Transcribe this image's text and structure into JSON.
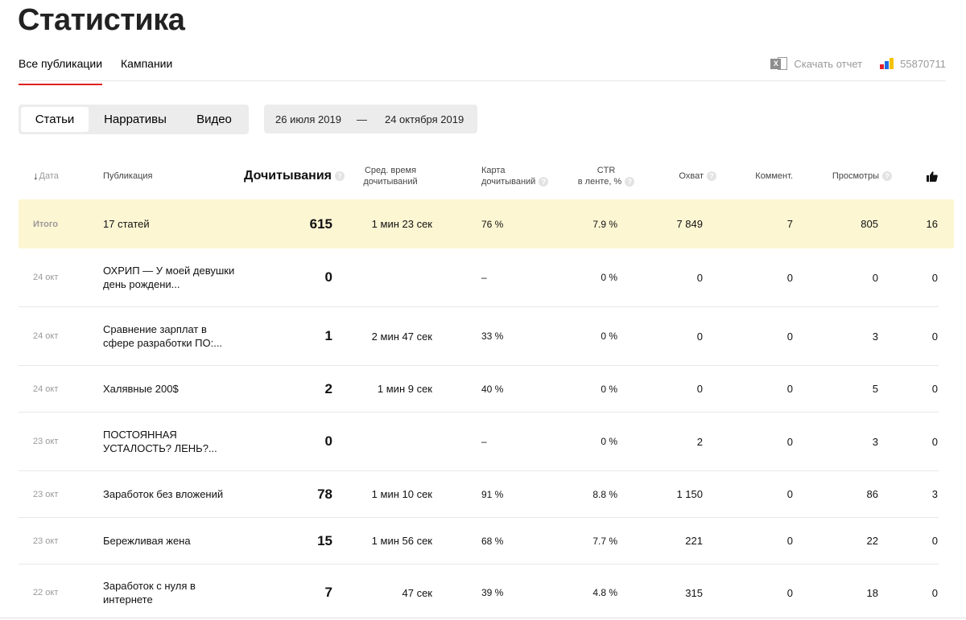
{
  "page": {
    "title": "Статистика"
  },
  "tabs": [
    {
      "label": "Все публикации",
      "active": true
    },
    {
      "label": "Кампании",
      "active": false
    }
  ],
  "actions": {
    "download_label": "Скачать отчет",
    "download_icon": "excel-icon",
    "counter_id": "55870711",
    "counter_icon": "metrica-icon"
  },
  "type_switch": {
    "options": [
      "Статьи",
      "Нарративы",
      "Видео"
    ],
    "selected": "Статьи"
  },
  "date_range": {
    "from": "26 июля 2019",
    "separator": "—",
    "to": "24 октября 2019"
  },
  "table": {
    "headers": {
      "date": "Дата",
      "publication": "Публикация",
      "reads": "Дочитывания",
      "avg_time_1": "Сред. время",
      "avg_time_2": "дочитываний",
      "map_1": "Карта",
      "map_2": "дочитываний",
      "ctr_1": "CTR",
      "ctr_2": "в ленте, %",
      "reach": "Охват",
      "comments": "Коммент.",
      "views": "Просмотры",
      "likes_icon": "thumbs-up-icon"
    },
    "total": {
      "label": "Итого",
      "title": "17 статей",
      "reads": "615",
      "avg_time": "1 мин 23 сек",
      "map": "76 %",
      "ctr": "7.9 %",
      "reach": "7 849",
      "comments": "7",
      "views": "805",
      "likes": "16"
    },
    "rows": [
      {
        "date": "24 окт",
        "title": "ОХРИП — У моей девушки день рождени...",
        "reads": "0",
        "avg_time": "",
        "map": "–",
        "ctr": "0 %",
        "reach": "0",
        "comments": "0",
        "views": "0",
        "likes": "0"
      },
      {
        "date": "24 окт",
        "title": "Сравнение зарплат в сфере разработки ПО:...",
        "reads": "1",
        "avg_time": "2 мин 47 сек",
        "map": "33 %",
        "ctr": "0 %",
        "reach": "0",
        "comments": "0",
        "views": "3",
        "likes": "0"
      },
      {
        "date": "24 окт",
        "title": "Халявные 200$",
        "reads": "2",
        "avg_time": "1 мин 9 сек",
        "map": "40 %",
        "ctr": "0 %",
        "reach": "0",
        "comments": "0",
        "views": "5",
        "likes": "0"
      },
      {
        "date": "23 окт",
        "title": "ПОСТОЯННАЯ УСТАЛОСТЬ? ЛЕНЬ?...",
        "reads": "0",
        "avg_time": "",
        "map": "–",
        "ctr": "0 %",
        "reach": "2",
        "comments": "0",
        "views": "3",
        "likes": "0"
      },
      {
        "date": "23 окт",
        "title": "Заработок без вложений",
        "reads": "78",
        "avg_time": "1 мин 10 сек",
        "map": "91 %",
        "ctr": "8.8 %",
        "reach": "1 150",
        "comments": "0",
        "views": "86",
        "likes": "3"
      },
      {
        "date": "23 окт",
        "title": "Бережливая жена",
        "reads": "15",
        "avg_time": "1 мин 56 сек",
        "map": "68 %",
        "ctr": "7.7 %",
        "reach": "221",
        "comments": "0",
        "views": "22",
        "likes": "0"
      },
      {
        "date": "22 окт",
        "title": "Заработок с нуля в интернете",
        "reads": "7",
        "avg_time": "47 сек",
        "map": "39 %",
        "ctr": "4.8 %",
        "reach": "315",
        "comments": "0",
        "views": "18",
        "likes": "0"
      }
    ]
  },
  "colors": {
    "accent_underline": "#e02020",
    "total_row_bg": "#fdf6d3"
  }
}
